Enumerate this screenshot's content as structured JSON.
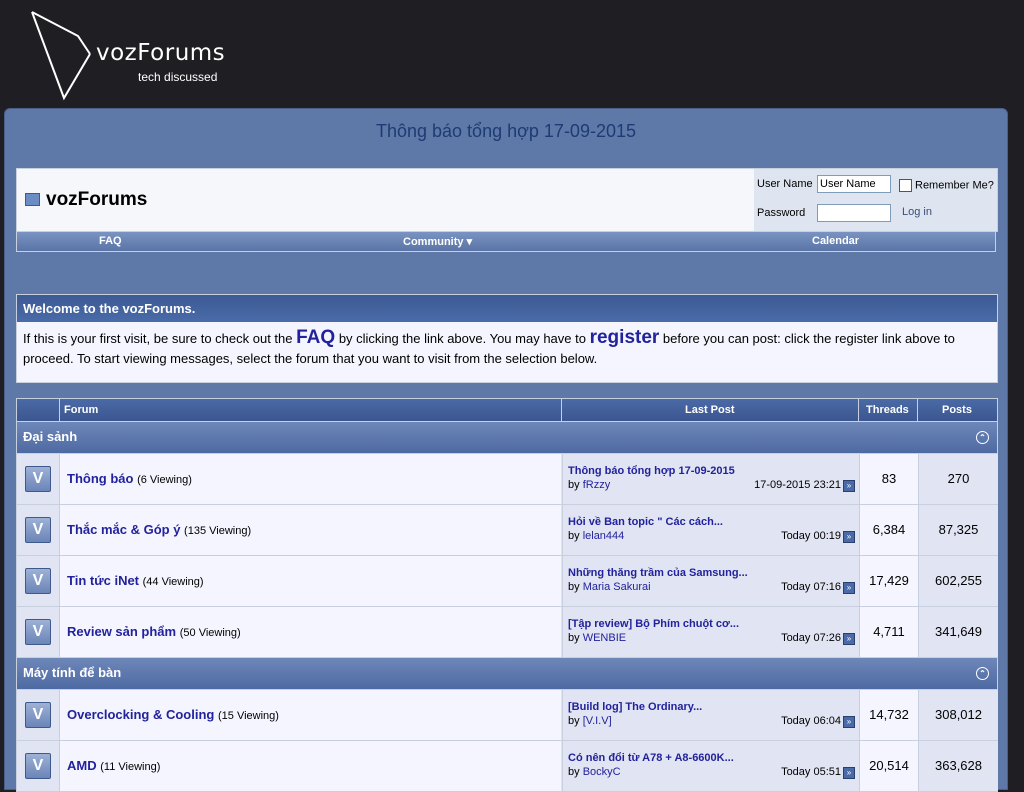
{
  "header": {
    "logo_name": "vozForums",
    "logo_tagline": "tech discussed"
  },
  "page_title": "Thông báo tổng hợp 17-09-2015",
  "breadcrumb": {
    "title": "vozForums"
  },
  "login": {
    "username_label": "User Name",
    "username_value": "User Name",
    "remember_label": "Remember Me?",
    "password_label": "Password",
    "login_button": "Log in"
  },
  "navbar": {
    "faq": "FAQ",
    "community": "Community",
    "calendar": "Calendar"
  },
  "welcome": {
    "title": "Welcome to the vozForums.",
    "text_1": "If this is your first visit, be sure to check out the",
    "faq_link": "FAQ",
    "text_2": "by clicking the link above. You may have to",
    "register_link": "register",
    "text_3": "before you can post: click the register link above to proceed. To start viewing messages, select the forum that you want to visit from the selection below."
  },
  "table": {
    "headers": {
      "forum": "Forum",
      "last_post": "Last Post",
      "threads": "Threads",
      "posts": "Posts"
    },
    "categories": [
      {
        "name": "Đại sảnh",
        "forums": [
          {
            "name": "Thông báo",
            "viewing": "(6 Viewing)",
            "last_title": "Thông báo tổng hợp 17-09-2015",
            "last_by": "by",
            "last_user": "fRzzy",
            "last_date": "17-09-2015 23:21",
            "threads": "83",
            "posts": "270"
          },
          {
            "name": "Thắc mắc & Góp ý",
            "viewing": "(135 Viewing)",
            "last_title": "Hỏi về Ban topic \" Các cách...",
            "last_by": "by",
            "last_user": "lelan444",
            "last_date": "Today 00:19",
            "threads": "6,384",
            "posts": "87,325"
          },
          {
            "name": "Tin tức iNet",
            "viewing": "(44 Viewing)",
            "last_title": "Những thăng trầm của Samsung...",
            "last_by": "by",
            "last_user": "Maria Sakurai",
            "last_date": "Today 07:16",
            "threads": "17,429",
            "posts": "602,255"
          },
          {
            "name": "Review sản phẩm",
            "viewing": "(50 Viewing)",
            "last_title": "[Tập review] Bộ Phím chuột cơ...",
            "last_by": "by",
            "last_user": "WENBIE",
            "last_date": "Today 07:26",
            "threads": "4,711",
            "posts": "341,649"
          }
        ]
      },
      {
        "name": "Máy tính để bàn",
        "forums": [
          {
            "name": "Overclocking & Cooling",
            "viewing": "(15 Viewing)",
            "last_title": "[Build log] The Ordinary...",
            "last_by": "by",
            "last_user": "[V.I.V]",
            "last_date": "Today 06:04",
            "threads": "14,732",
            "posts": "308,012"
          },
          {
            "name": "AMD",
            "viewing": "(11 Viewing)",
            "last_title": "Có nên đổi từ A78 + A8-6600K...",
            "last_by": "by",
            "last_user": "BockyC",
            "last_date": "Today 05:51",
            "threads": "20,514",
            "posts": "363,628"
          }
        ]
      }
    ]
  }
}
